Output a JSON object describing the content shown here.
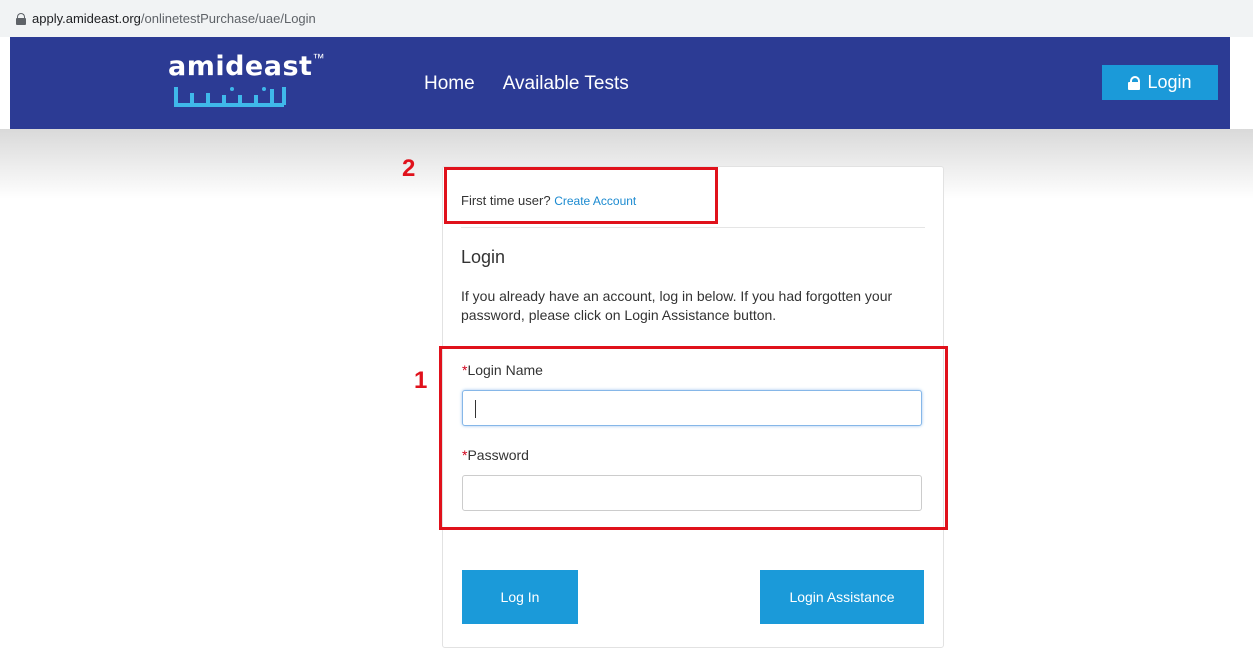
{
  "browser": {
    "url_host": "apply.amideast.org",
    "url_path": "/onlinetestPurchase/uae/Login"
  },
  "header": {
    "logo_text": "amideast",
    "logo_tm": "™",
    "nav": [
      "Home",
      "Available Tests"
    ],
    "login_label": "Login",
    "brand_color": "#2c3b94",
    "accent_color": "#1b9ad9"
  },
  "card": {
    "first_time_text": "First time user?",
    "create_account_link": "Create Account",
    "title": "Login",
    "intro": "If you already have an account, log in below. If you had forgotten your password, please click on Login Assistance button.",
    "required_mark": "*",
    "login_name_label": "Login Name",
    "login_name_value": "",
    "password_label": "Password",
    "password_value": "",
    "login_button": "Log In",
    "assistance_button": "Login Assistance"
  },
  "annotations": {
    "box1_label": "1",
    "box2_label": "2",
    "color": "#e0111b"
  }
}
